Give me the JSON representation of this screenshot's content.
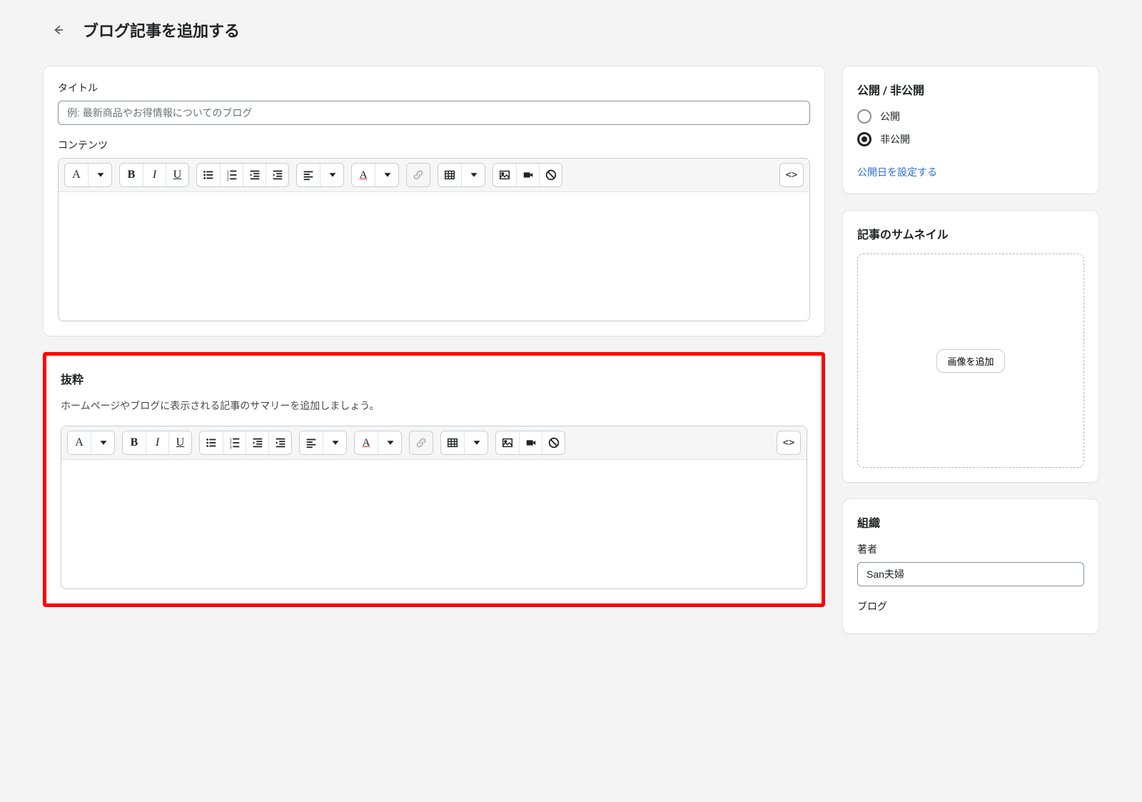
{
  "header": {
    "page_title": "ブログ記事を追加する"
  },
  "main": {
    "title_field": {
      "label": "タイトル",
      "placeholder": "例: 最新商品やお得情報についてのブログ",
      "value": ""
    },
    "content_field": {
      "label": "コンテンツ",
      "value": ""
    },
    "excerpt": {
      "title": "抜粋",
      "help": "ホームページやブログに表示される記事のサマリーを追加しましょう。",
      "value": ""
    }
  },
  "sidebar": {
    "visibility": {
      "title": "公開 / 非公開",
      "options": {
        "public": "公開",
        "private": "非公開"
      },
      "selected": "private",
      "schedule_link": "公開日を設定する"
    },
    "thumbnail": {
      "title": "記事のサムネイル",
      "add_button": "画像を追加"
    },
    "organization": {
      "title": "組織",
      "author_label": "著者",
      "author_value": "San夫婦",
      "blog_label": "ブログ"
    }
  },
  "toolbar_icons": {
    "paragraph": "A",
    "bold": "B",
    "italic": "I",
    "underline": "U",
    "text_color": "A"
  }
}
